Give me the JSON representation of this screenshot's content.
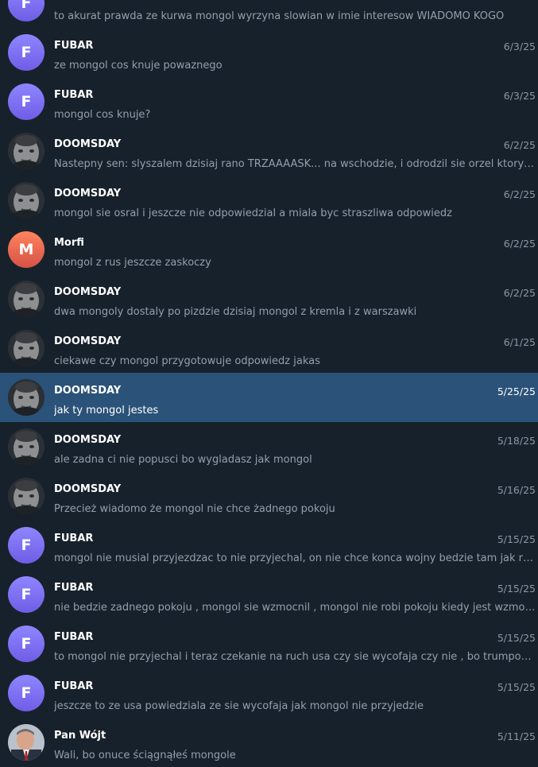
{
  "chats": [
    {
      "name": "",
      "initial": "F",
      "avatar": "fubar",
      "date": "",
      "message": "to akurat prawda ze kurwa mongol wyrzyna slowian w imie interesow WIADOMO KOGO"
    },
    {
      "name": "FUBAR",
      "initial": "F",
      "avatar": "fubar",
      "date": "6/3/25",
      "message": "ze mongol cos knuje powaznego"
    },
    {
      "name": "FUBAR",
      "initial": "F",
      "avatar": "fubar",
      "date": "6/3/25",
      "message": "mongol cos knuje?"
    },
    {
      "name": "DOOMSDAY",
      "initial": "",
      "avatar": "photo",
      "date": "6/2/25",
      "message": "Nastepny sen: slyszalem dzisiaj rano TRZAAAASK... na wschodzie, i odrodzil sie orzel ktory wydlubal oczy mongolowi"
    },
    {
      "name": "DOOMSDAY",
      "initial": "",
      "avatar": "photo",
      "date": "6/2/25",
      "message": "mongol sie osral i jeszcze nie odpowiedzial a miala byc straszliwa odpowiedz"
    },
    {
      "name": "Morfi",
      "initial": "M",
      "avatar": "morfi",
      "date": "6/2/25",
      "message": "mongol z rus jeszcze zaskoczy"
    },
    {
      "name": "DOOMSDAY",
      "initial": "",
      "avatar": "photo",
      "date": "6/2/25",
      "message": "dwa mongoly dostaly po pizdzie dzisiaj mongol z kremla i z warszawki"
    },
    {
      "name": "DOOMSDAY",
      "initial": "",
      "avatar": "photo",
      "date": "6/1/25",
      "message": "ciekawe czy mongol przygotowuje odpowiedz jakas"
    },
    {
      "name": "DOOMSDAY",
      "initial": "",
      "avatar": "photo",
      "date": "5/25/25",
      "message": "jak ty mongol jestes",
      "selected": true
    },
    {
      "name": "DOOMSDAY",
      "initial": "",
      "avatar": "photo",
      "date": "5/18/25",
      "message": "ale zadna ci nie popusci bo wygladasz jak mongol"
    },
    {
      "name": "DOOMSDAY",
      "initial": "",
      "avatar": "photo",
      "date": "5/16/25",
      "message": "Przecież wiadomo że mongol nie chce żadnego pokoju"
    },
    {
      "name": "FUBAR",
      "initial": "F",
      "avatar": "fubar",
      "date": "5/15/25",
      "message": "mongol nie musial przyjezdzac to nie przyjechal, on nie chce konca wojny bedzie tam jak rak wiercil"
    },
    {
      "name": "FUBAR",
      "initial": "F",
      "avatar": "fubar",
      "date": "5/15/25",
      "message": "nie bedzie zadnego pokoju , mongol sie wzmocnil , mongol nie robi pokoju kiedy jest wzmocniony"
    },
    {
      "name": "FUBAR",
      "initial": "F",
      "avatar": "fubar",
      "date": "5/15/25",
      "message": "to mongol nie przyjechal i teraz czekanie na ruch usa czy sie wycofaja czy nie , bo trumpowi nie udalo sie"
    },
    {
      "name": "FUBAR",
      "initial": "F",
      "avatar": "fubar",
      "date": "5/15/25",
      "message": "jeszcze to ze usa powiedziala ze sie wycofaja jak mongol nie przyjedzie"
    },
    {
      "name": "Pan Wójt",
      "initial": "",
      "avatar": "pan",
      "date": "5/11/25",
      "message": "Wali, bo onuce ściągnąłeś mongole"
    }
  ],
  "colors": {
    "background": "#17212b",
    "selected": "#2b5278",
    "name": "#ffffff",
    "message": "#91a0ad",
    "date": "#8b98a5"
  },
  "icons": {
    "photo_avatar": "person-photo-icon",
    "pan_avatar": "person-photo-icon"
  }
}
